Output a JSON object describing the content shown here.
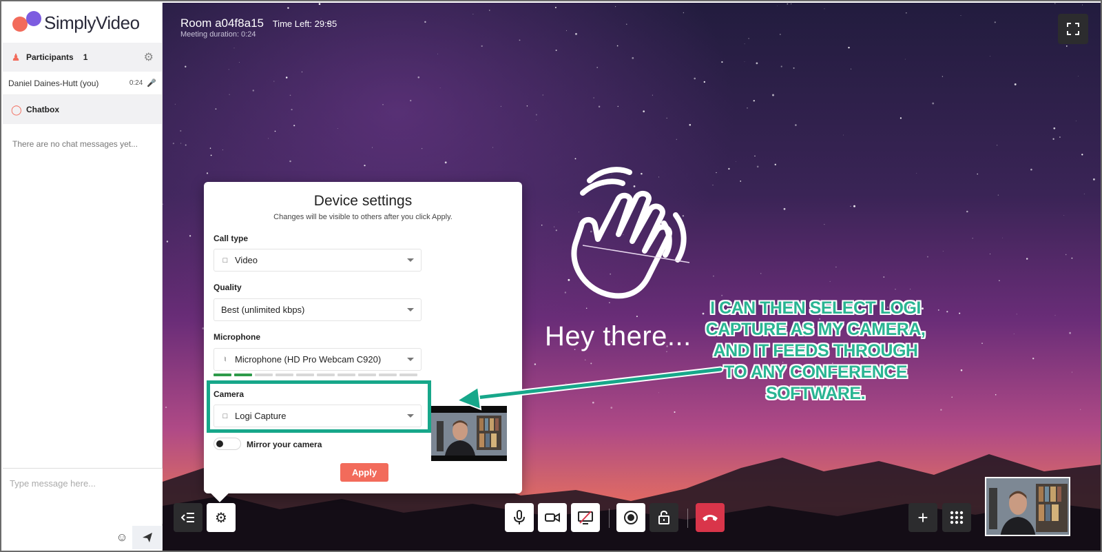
{
  "app": {
    "name": "SimplyVideo"
  },
  "sidebar": {
    "participants_label": "Participants",
    "participants_count": "1",
    "participant": {
      "name": "Daniel Daines-Hutt (you)",
      "time": "0:24"
    },
    "chatbox_label": "Chatbox",
    "chat_empty": "There are no chat messages yet...",
    "chat_placeholder": "Type message here..."
  },
  "room": {
    "title": "Room a04f8a15",
    "time_left": "Time Left: 29:35",
    "duration": "Meeting duration: 0:24"
  },
  "greeting": "Hey there...",
  "modal": {
    "title": "Device settings",
    "subtitle": "Changes will be visible to others after you click Apply.",
    "call_type_label": "Call type",
    "call_type_value": "Video",
    "quality_label": "Quality",
    "quality_value": "Best (unlimited kbps)",
    "microphone_label": "Microphone",
    "microphone_value": "Microphone (HD Pro Webcam C920)",
    "mic_level_segments": 10,
    "mic_level_active": 2,
    "camera_label": "Camera",
    "camera_value": "Logi Capture",
    "mirror_label": "Mirror your camera",
    "mirror_enabled": false,
    "apply_label": "Apply"
  },
  "annotation": "i CAN THEN SELECT LOGI CAPTURE AS MY CAMERA, AND IT FEEDS THROUGH TO ANY CONFERENCE SOFTWARE.",
  "colors": {
    "accent": "#f26b5b",
    "brand_purple": "#7c5ce0",
    "annotation": "#17a78a",
    "hangup": "#d9354a",
    "level_on": "#2e9a4a"
  },
  "icons": {
    "participants": "people-icon",
    "settings": "gear-icon",
    "chat": "chat-bubble-icon",
    "fullscreen": "fullscreen-icon",
    "toolbar": [
      "collapse-sidebar-icon",
      "gear-icon",
      "microphone-icon",
      "camera-icon",
      "screen-share-off-icon",
      "record-icon",
      "lock-icon",
      "hang-up-icon",
      "plus-icon",
      "grid-icon"
    ]
  }
}
